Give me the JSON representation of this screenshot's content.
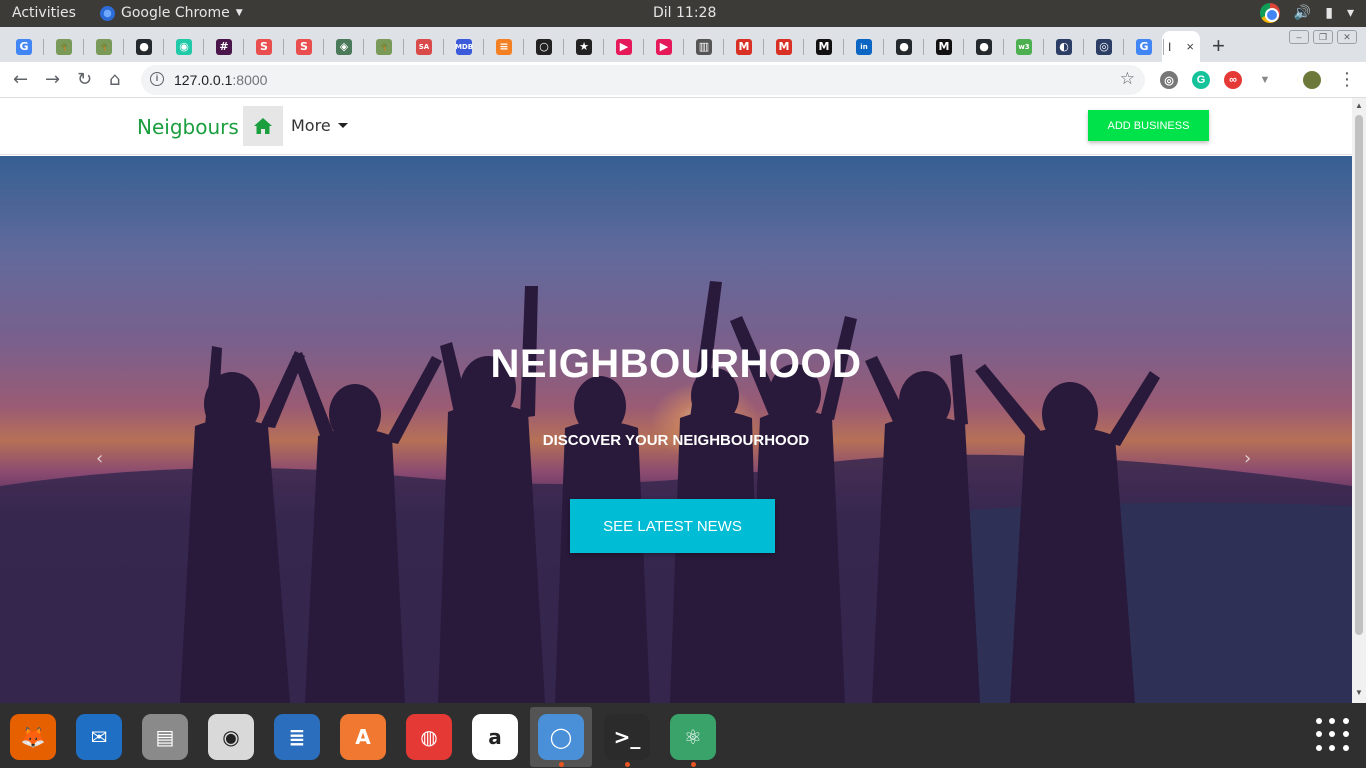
{
  "topbar": {
    "activities": "Activities",
    "app_name": "Google Chrome",
    "clock": "Dil 11:28"
  },
  "tabs": [
    {
      "icon": "google-icon",
      "glyph": "G",
      "color": "#4285f4"
    },
    {
      "icon": "tree-icon",
      "glyph": "🌴",
      "color": "#7a9a5a"
    },
    {
      "icon": "tree-icon",
      "glyph": "🌴",
      "color": "#7a9a5a"
    },
    {
      "icon": "github-icon",
      "glyph": "●",
      "color": "#24292e"
    },
    {
      "icon": "colorful-circle-icon",
      "glyph": "◉",
      "color": "#20c9a8"
    },
    {
      "icon": "slack-icon",
      "glyph": "#",
      "color": "#4a154b"
    },
    {
      "icon": "sololearn-icon",
      "glyph": "S",
      "color": "#e94f4f"
    },
    {
      "icon": "sololearn-icon",
      "glyph": "S",
      "color": "#e94f4f"
    },
    {
      "icon": "diamond-icon",
      "glyph": "◈",
      "color": "#4a7a5a"
    },
    {
      "icon": "tree-icon",
      "glyph": "🌴",
      "color": "#7a9a5a"
    },
    {
      "icon": "sa-icon",
      "glyph": "SA",
      "color": "#d94a4a"
    },
    {
      "icon": "mdb-icon",
      "glyph": "MDB",
      "color": "#3b5bdb"
    },
    {
      "icon": "stackoverflow-icon",
      "glyph": "≡",
      "color": "#f48024"
    },
    {
      "icon": "circle-icon",
      "glyph": "○",
      "color": "#222222"
    },
    {
      "icon": "star-icon",
      "glyph": "★",
      "color": "#222222"
    },
    {
      "icon": "play-icon",
      "glyph": "▶",
      "color": "#e6195a"
    },
    {
      "icon": "play-icon",
      "glyph": "▶",
      "color": "#e6195a"
    },
    {
      "icon": "book-icon",
      "glyph": "▥",
      "color": "#555555"
    },
    {
      "icon": "gmail-icon",
      "glyph": "M",
      "color": "#d93025"
    },
    {
      "icon": "gmail-icon",
      "glyph": "M",
      "color": "#d93025"
    },
    {
      "icon": "medium-icon",
      "glyph": "M",
      "color": "#111111"
    },
    {
      "icon": "linkedin-icon",
      "glyph": "in",
      "color": "#0a66c2"
    },
    {
      "icon": "github-icon",
      "glyph": "●",
      "color": "#24292e"
    },
    {
      "icon": "medium-icon",
      "glyph": "M",
      "color": "#111111"
    },
    {
      "icon": "github-icon",
      "glyph": "●",
      "color": "#24292e"
    },
    {
      "icon": "w3-icon",
      "glyph": "w3",
      "color": "#4caf50"
    },
    {
      "icon": "circle-arrow-icon",
      "glyph": "◐",
      "color": "#2c3e66"
    },
    {
      "icon": "person-circle-icon",
      "glyph": "◎",
      "color": "#2c3e66"
    },
    {
      "icon": "google-icon",
      "glyph": "G",
      "color": "#4285f4"
    }
  ],
  "active_tab": {
    "glyph": "I",
    "close": "×"
  },
  "toolbar": {
    "url_host": "127.0.0.1",
    "url_port": ":8000"
  },
  "site": {
    "brand": "Neigbours",
    "more_label": "More",
    "add_business": "ADD BUSINESS",
    "hero_title": "NEIGHBOURHOOD",
    "hero_subtitle": "DISCOVER YOUR NEIGHBOURHOOD",
    "hero_button": "SEE LATEST NEWS",
    "prev_arrow": "‹",
    "next_arrow": "›"
  },
  "colors": {
    "brand": "#1b9e3e",
    "add_business_bg": "#00e24a",
    "hero_button_bg": "#00bcd4"
  },
  "dock": [
    {
      "name": "firefox-icon",
      "glyph": "🦊",
      "bg": "#e66000",
      "running": false
    },
    {
      "name": "thunderbird-icon",
      "glyph": "✉",
      "bg": "#1f6fc5",
      "running": false
    },
    {
      "name": "files-icon",
      "glyph": "▤",
      "bg": "#8a8a8a",
      "running": false
    },
    {
      "name": "rhythmbox-icon",
      "glyph": "◉",
      "bg": "#d9d9d9",
      "running": false
    },
    {
      "name": "writer-icon",
      "glyph": "≣",
      "bg": "#2a6ebd",
      "running": false
    },
    {
      "name": "software-center-icon",
      "glyph": "A",
      "bg": "#f07830",
      "running": false
    },
    {
      "name": "help-icon",
      "glyph": "◍",
      "bg": "#e53935",
      "running": false
    },
    {
      "name": "amazon-icon",
      "glyph": "a",
      "bg": "#ffffff",
      "running": false
    },
    {
      "name": "chrome-dock-icon",
      "glyph": "◯",
      "bg": "#4a90d9",
      "running": true
    },
    {
      "name": "terminal-icon",
      "glyph": ">_",
      "bg": "#2b2b2b",
      "running": true
    },
    {
      "name": "atom-icon",
      "glyph": "⚛",
      "bg": "#39a36a",
      "running": true
    }
  ]
}
